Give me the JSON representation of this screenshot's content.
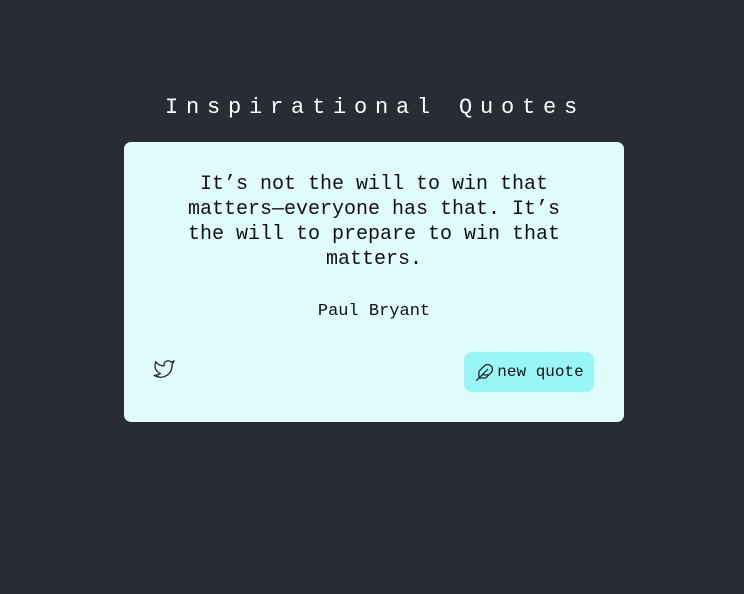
{
  "page": {
    "title": "Inspirational Quotes"
  },
  "quote": {
    "text": "It’s not the will to win that matters—everyone has that. It’s the will to prepare to win that matters.",
    "author": "Paul Bryant"
  },
  "actions": {
    "tweet_icon": "twitter-icon",
    "new_quote_icon": "feather-icon",
    "new_quote_label": "new quote"
  },
  "colors": {
    "background": "#282c34",
    "card": "#e0fcff",
    "button": "#99f6f7",
    "text": "#111111"
  }
}
